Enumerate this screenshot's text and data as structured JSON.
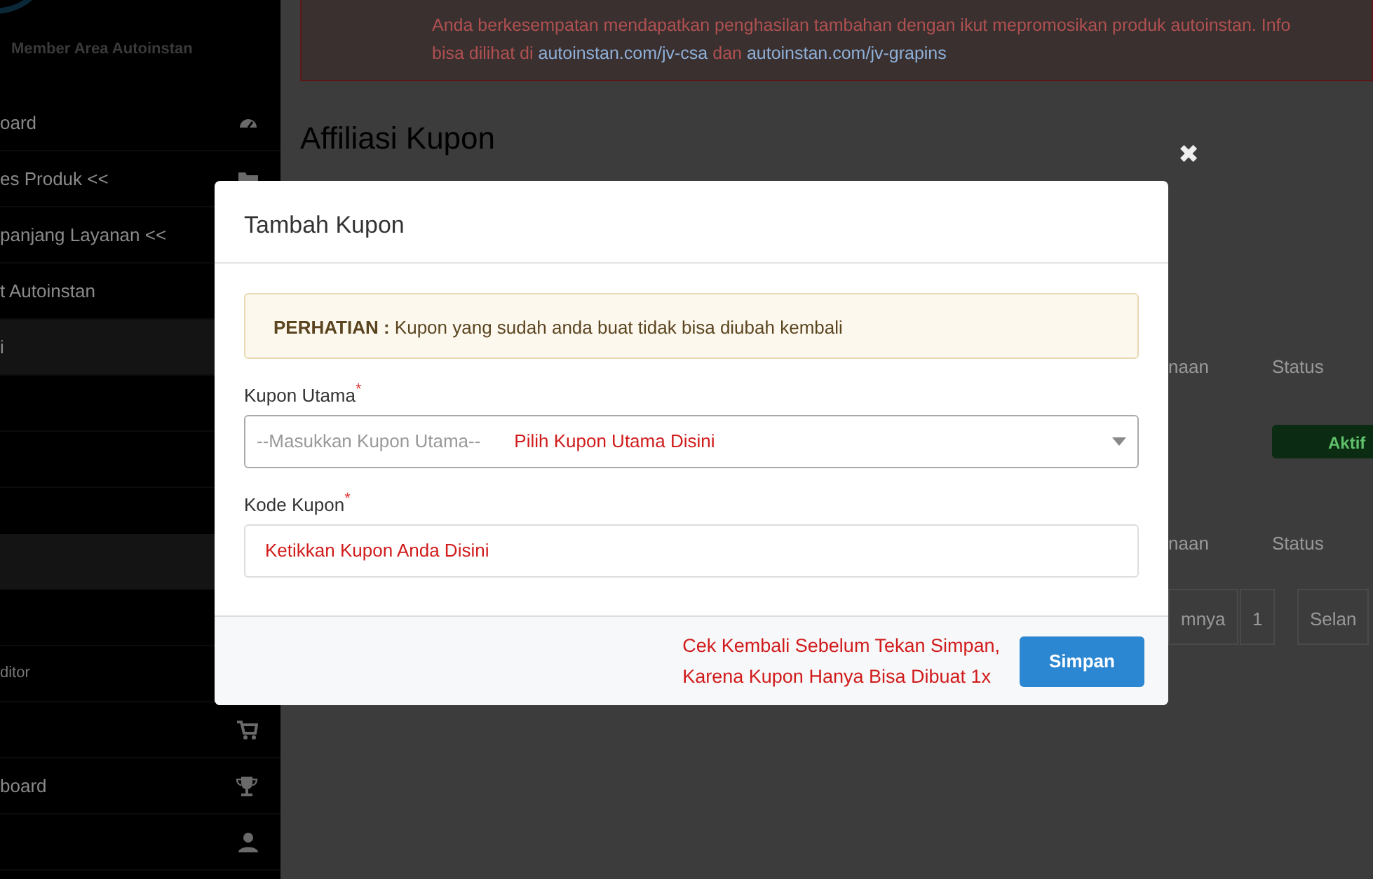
{
  "sidebar": {
    "brand": "Member Area Autoinstan",
    "items": [
      {
        "label": "oard",
        "selected": false
      },
      {
        "label": "es Produk <<",
        "selected": false
      },
      {
        "label": "panjang Layanan <<",
        "selected": false
      },
      {
        "label": "t Autoinstan",
        "selected": false
      },
      {
        "label": "i",
        "selected": true
      },
      {
        "selected": false
      },
      {
        "selected": false
      },
      {
        "selected": true
      },
      {
        "selected": false
      },
      {
        "label": "ditor",
        "selected": false
      },
      {
        "selected": false
      },
      {
        "label": "board",
        "selected": false
      },
      {
        "selected": false
      }
    ]
  },
  "notice": {
    "line_1": "Anda berkesempatan mendapatkan penghasilan tambahan dengan ikut mepromosikan produk autoinstan. Info",
    "line_2_prefix": "bisa dilihat di",
    "link_1": "autoinstan.com/jv-csa",
    "joiner": "dan",
    "link_2": "autoinstan.com/jv-grapins"
  },
  "page_title": "Affiliasi Kupon",
  "table_1": {
    "columns": [
      "naan",
      "Status"
    ],
    "status": "Aktif"
  },
  "table_2": {
    "columns": [
      "naan",
      "Status"
    ]
  },
  "pagination": [
    "mnya",
    "1",
    "Selan"
  ],
  "modal": {
    "title": "Tambah Kupon",
    "close": "✖",
    "warning_label": "PERHATIAN :",
    "warning_text": "Kupon yang sudah anda buat tidak bisa diubah kembali",
    "fields": [
      {
        "kind": "select",
        "label": "Kupon Utama",
        "required_mark": "*",
        "placeholder": "--Masukkan Kupon Utama--",
        "annotation": "Pilih Kupon Utama Disini"
      },
      {
        "kind": "text",
        "label": "Kode Kupon",
        "required_mark": "*",
        "annotation": "Ketikkan Kupon Anda Disini"
      }
    ],
    "footer_note": [
      "Cek Kembali Sebelum Tekan Simpan,",
      "Karena Kupon Hanya Bisa Dibuat 1x"
    ],
    "save_button": "Simpan"
  }
}
